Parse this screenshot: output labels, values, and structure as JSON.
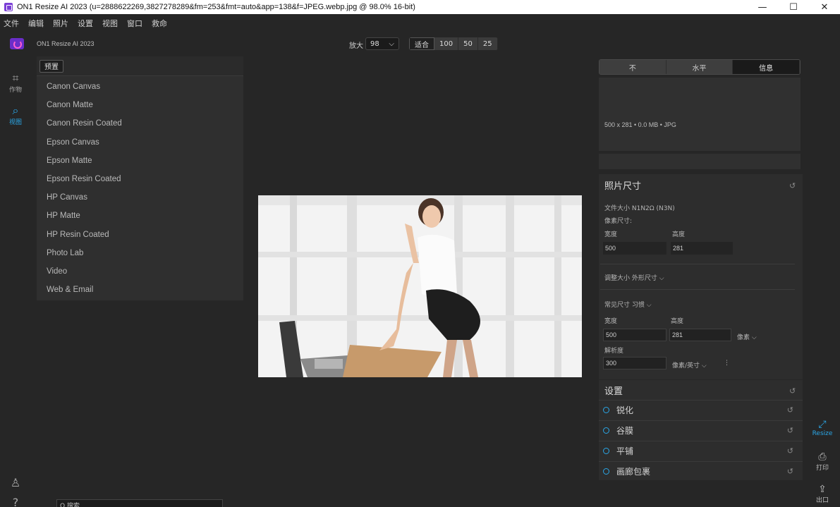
{
  "window": {
    "title": "ON1 Resize AI 2023 (u=2888622269,3827278289&fm=253&fmt=auto&app=138&f=JPEG.webp.jpg @ 98.0% 16-bit)",
    "minimize": "—",
    "maximize": "☐",
    "close": "✕"
  },
  "menu": [
    "文件",
    "编辑",
    "照片",
    "设置",
    "视图",
    "窗口",
    "救命"
  ],
  "app_name": "ON1 Resize AI 2023",
  "zoom": {
    "label": "放大",
    "value": "98",
    "chevron": "⌵",
    "fit": "适合",
    "presets": [
      "100",
      "50",
      "25"
    ]
  },
  "left_tools": {
    "crop_label": "作物",
    "view_label": "视图"
  },
  "preset_panel": {
    "button": "预置",
    "items": [
      "Canon Canvas",
      "Canon Matte",
      "Canon Resin Coated",
      "Epson Canvas",
      "Epson Matte",
      "Epson Resin Coated",
      "HP Canvas",
      "HP Matte",
      "HP Resin Coated",
      "Photo Lab",
      "Video",
      "Web & Email"
    ]
  },
  "search": {
    "text": "Q 搜索"
  },
  "view_tabs": [
    "不",
    "水平",
    "信息"
  ],
  "image_info": "500 x 281 • 0.0 MB • JPG",
  "photo_size": {
    "title": "照片尺寸",
    "file_size": "文件大小 N1N2Ω (N3N)",
    "pixel_dims": "像素尺寸:",
    "width_label": "宽度",
    "height_label": "高度",
    "width": "500",
    "height": "281",
    "resize_to": "调整大小 外形尺寸 ⌵",
    "doc_size": "常见尺寸 习惯 ⌵",
    "width2_label": "宽度",
    "height2_label": "高度",
    "width2": "500",
    "height2": "281",
    "unit": "像素 ⌵",
    "resolution_label": "解析度",
    "resolution": "300",
    "resolution_unit": "像素/英寸 ⌵",
    "more": "⋮"
  },
  "settings": {
    "title": "设置",
    "items": [
      "锐化",
      "谷膜",
      "平铺",
      "画廊包裹"
    ]
  },
  "right_tools": {
    "resize": "Resize",
    "print": "打印",
    "export": "出口"
  },
  "colors": {
    "accent": "#2aa6e6",
    "brand": "#6a2ec9"
  }
}
